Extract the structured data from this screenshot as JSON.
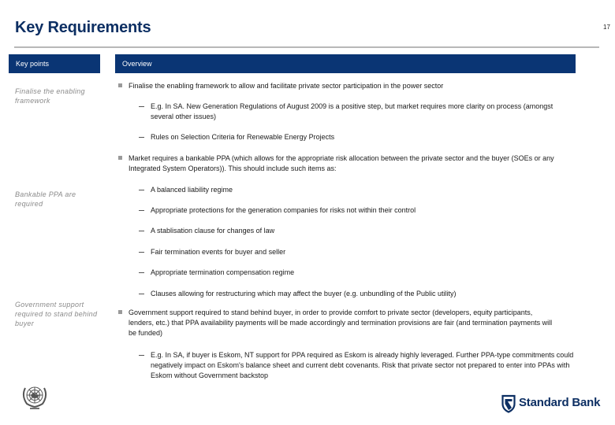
{
  "page": {
    "title": "Key Requirements",
    "page_number": "17"
  },
  "headers": {
    "key_points": "Key points",
    "overview": "Overview"
  },
  "key_points": [
    "Finalise the enabling framework",
    "Bankable PPA are required",
    "Government support required to stand behind buyer"
  ],
  "sections": [
    {
      "bullet": "Finalise the enabling framework to allow and facilitate private sector participation in the power sector",
      "sub_items": [
        "E.g. In SA. New Generation Regulations of August 2009 is a positive step, but market requires more clarity on process (amongst several other issues)",
        "Rules on Selection Criteria for Renewable Energy Projects"
      ]
    },
    {
      "bullet": "Market requires a bankable PPA (which allows for the appropriate risk allocation between the private sector and the buyer (SOEs or any Integrated System Operators)). This should include such items as:",
      "sub_items": [
        "A balanced liability regime",
        "Appropriate protections for the generation companies for risks not within their control",
        "A stablisation clause for changes of law",
        "Fair termination events for buyer and seller",
        "Appropriate termination compensation regime",
        "Clauses allowing for restructuring which may affect the buyer (e.g. unbundling of the Public utility)"
      ]
    },
    {
      "bullet": "Government support required to stand behind buyer, in order to provide comfort to private sector (developers, equity participants, lenders, etc.) that PPA availability payments will be made accordingly and termination provisions are fair (and termination payments will be funded)",
      "sub_items": [
        "E.g. In SA, if buyer is Eskom, NT support for PPA required as Eskom is already highly leveraged. Further PPA-type commitments could negatively impact on Eskom's balance sheet and current debt covenants. Risk that private sector not prepared to enter into PPAs with Eskom without Government backstop"
      ]
    }
  ],
  "footer": {
    "left_logo": "un-emblem-icon",
    "right_logo": "standard-bank-logo",
    "brand_name": "Standard Bank"
  },
  "colors": {
    "brand_navy": "#0a3574",
    "title_navy": "#0d2f63",
    "key_text_gray": "#8a8a8a"
  }
}
